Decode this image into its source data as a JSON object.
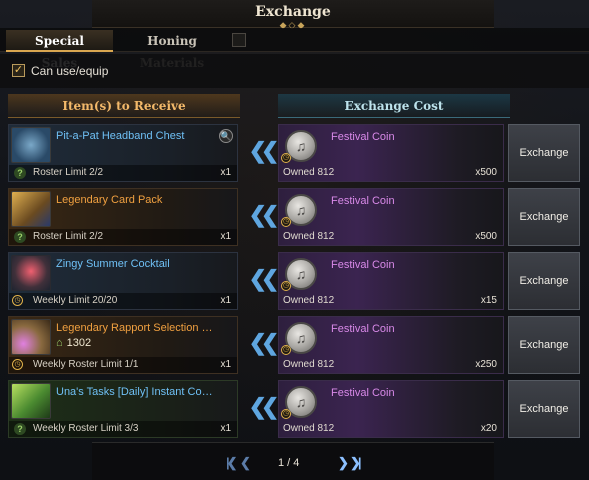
{
  "window": {
    "title": "Exchange"
  },
  "tabs": [
    {
      "label": "Special Sales",
      "active": true
    },
    {
      "label": "Honing Materials",
      "active": false
    }
  ],
  "filter": {
    "label": "Can use/equip",
    "checked": true
  },
  "columns": {
    "receive": "Item(s) to Receive",
    "cost": "Exchange Cost"
  },
  "rows": [
    {
      "item": "Pit-a-Pat Headband Chest",
      "item_color": "#6fc0f5",
      "limit": "Roster Limit 2/2",
      "limit_icon": "question-icon",
      "qty": "x1",
      "currency": "Festival Coin",
      "owned": "Owned 812",
      "price": "x500",
      "button": "Exchange",
      "has_search": true
    },
    {
      "item": "Legendary Card Pack",
      "item_color": "#f0a040",
      "limit": "Roster Limit 2/2",
      "limit_icon": "question-icon",
      "qty": "x1",
      "currency": "Festival Coin",
      "owned": "Owned 812",
      "price": "x500",
      "button": "Exchange"
    },
    {
      "item": "Zingy Summer Cocktail",
      "item_color": "#6fc0f5",
      "limit": "Weekly Limit 20/20",
      "limit_icon": "clock-icon",
      "qty": "x1",
      "currency": "Festival Coin",
      "owned": "Owned 812",
      "price": "x15",
      "button": "Exchange"
    },
    {
      "item": "Legendary Rapport Selection C...",
      "item_color": "#f0a040",
      "badge_value": "1302",
      "limit": "Weekly Roster Limit 1/1",
      "limit_icon": "clock-icon",
      "qty": "x1",
      "currency": "Festival Coin",
      "owned": "Owned 812",
      "price": "x250",
      "button": "Exchange"
    },
    {
      "item": "Una's Tasks [Daily] Instant Com...",
      "item_color": "#6fc0f5",
      "limit": "Weekly Roster Limit 3/3",
      "limit_icon": "question-icon",
      "qty": "x1",
      "currency": "Festival Coin",
      "owned": "Owned 812",
      "price": "x20",
      "button": "Exchange"
    }
  ],
  "pager": {
    "text": "1 / 4"
  }
}
